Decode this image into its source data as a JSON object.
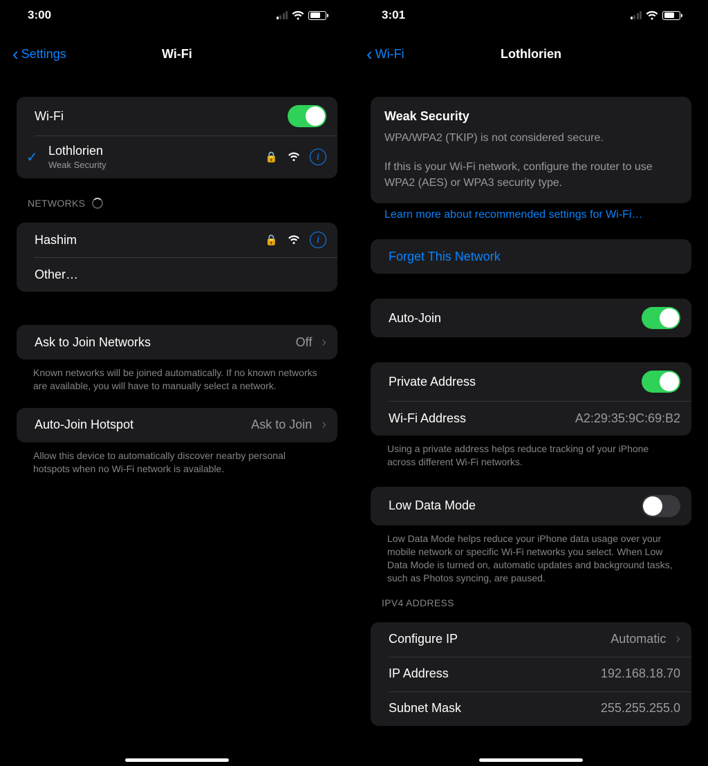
{
  "left": {
    "status": {
      "time": "3:00"
    },
    "nav": {
      "back": "Settings",
      "title": "Wi-Fi"
    },
    "wifi_row": {
      "label": "Wi-Fi",
      "on": true
    },
    "connected": {
      "name": "Lothlorien",
      "sub": "Weak Security"
    },
    "networks_header": "NETWORKS",
    "networks": [
      {
        "name": "Hashim"
      }
    ],
    "other": "Other…",
    "ask": {
      "label": "Ask to Join Networks",
      "value": "Off"
    },
    "ask_footer": "Known networks will be joined automatically. If no known networks are available, you will have to manually select a network.",
    "hotspot": {
      "label": "Auto-Join Hotspot",
      "value": "Ask to Join"
    },
    "hotspot_footer": "Allow this device to automatically discover nearby personal hotspots when no Wi-Fi network is available."
  },
  "right": {
    "status": {
      "time": "3:01"
    },
    "nav": {
      "back": "Wi-Fi",
      "title": "Lothlorien"
    },
    "security": {
      "title": "Weak Security",
      "line1": "WPA/WPA2 (TKIP) is not considered secure.",
      "line2": "If this is your Wi-Fi network, configure the router to use WPA2 (AES) or WPA3 security type."
    },
    "learn_more": "Learn more about recommended settings for Wi-Fi…",
    "forget": "Forget This Network",
    "auto_join": {
      "label": "Auto-Join",
      "on": true
    },
    "private_addr": {
      "label": "Private Address",
      "on": true
    },
    "wifi_addr": {
      "label": "Wi-Fi Address",
      "value": "A2:29:35:9C:69:B2"
    },
    "private_footer": "Using a private address helps reduce tracking of your iPhone across different Wi-Fi networks.",
    "low_data": {
      "label": "Low Data Mode",
      "on": false
    },
    "low_data_footer": "Low Data Mode helps reduce your iPhone data usage over your mobile network or specific Wi-Fi networks you select. When Low Data Mode is turned on, automatic updates and background tasks, such as Photos syncing, are paused.",
    "ipv4_header": "IPV4 ADDRESS",
    "configure_ip": {
      "label": "Configure IP",
      "value": "Automatic"
    },
    "ip": {
      "label": "IP Address",
      "value": "192.168.18.70"
    },
    "subnet": {
      "label": "Subnet Mask",
      "value": "255.255.255.0"
    }
  }
}
